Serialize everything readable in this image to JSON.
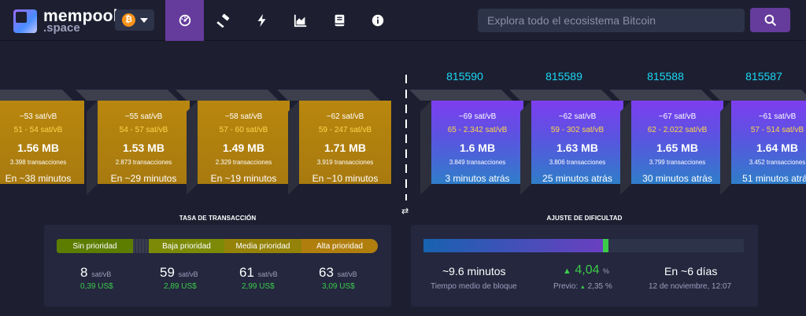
{
  "brand": {
    "name": "mempool",
    "suffix": ".space"
  },
  "network": {
    "icon": "bitcoin-icon",
    "symbol": "₿"
  },
  "nav": [
    {
      "name": "dashboard-icon",
      "active": true
    },
    {
      "name": "hammer-icon",
      "active": false
    },
    {
      "name": "lightning-icon",
      "active": false
    },
    {
      "name": "graphs-icon",
      "active": false
    },
    {
      "name": "docs-icon",
      "active": false
    },
    {
      "name": "info-icon",
      "active": false
    }
  ],
  "search": {
    "placeholder": "Explora todo el ecosistema Bitcoin"
  },
  "mempool_blocks": [
    {
      "fee": "~53 sat/vB",
      "range": "51 - 54 sat/vB",
      "size": "1.56 MB",
      "tx": "3.398 transacciones",
      "time": "En ~38 minutos"
    },
    {
      "fee": "~55 sat/vB",
      "range": "54 - 57 sat/vB",
      "size": "1.53 MB",
      "tx": "2.873 transacciones",
      "time": "En ~29 minutos"
    },
    {
      "fee": "~58 sat/vB",
      "range": "57 - 60 sat/vB",
      "size": "1.49 MB",
      "tx": "2.329 transacciones",
      "time": "En ~19 minutos"
    },
    {
      "fee": "~62 sat/vB",
      "range": "59 - 247 sat/vB",
      "size": "1.71 MB",
      "tx": "3.919 transacciones",
      "time": "En ~10 minutos"
    }
  ],
  "mined_blocks": [
    {
      "height": "815590",
      "fee": "~69 sat/vB",
      "range": "65 - 2.342 sat/vB",
      "size": "1.6 MB",
      "tx": "3.849 transacciones",
      "time": "3 minutos atrás"
    },
    {
      "height": "815589",
      "fee": "~62 sat/vB",
      "range": "59 - 302 sat/vB",
      "size": "1.63 MB",
      "tx": "3.806 transacciones",
      "time": "25 minutos atrás"
    },
    {
      "height": "815588",
      "fee": "~67 sat/vB",
      "range": "62 - 2.022 sat/vB",
      "size": "1.65 MB",
      "tx": "3.799 transacciones",
      "time": "30 minutos atrás"
    },
    {
      "height": "815587",
      "fee": "~61 sat/vB",
      "range": "57 - 514 sat/vB",
      "size": "1.64 MB",
      "tx": "3.452 transacciones",
      "time": "51 minutos atrás"
    }
  ],
  "swap_symbol": "⇄",
  "fees": {
    "title": "TASA DE TRANSACCIÓN",
    "levels": [
      {
        "label": "Sin prioridad",
        "value": "8",
        "unit": "sat/vB",
        "usd": "0,39 US$"
      },
      {
        "label": "Baja prioridad",
        "value": "59",
        "unit": "sat/vB",
        "usd": "2,89 US$"
      },
      {
        "label": "Media prioridad",
        "value": "61",
        "unit": "sat/vB",
        "usd": "2,99 US$"
      },
      {
        "label": "Alta prioridad",
        "value": "63",
        "unit": "sat/vB",
        "usd": "3,09 US$"
      }
    ]
  },
  "difficulty": {
    "title": "AJUSTE DE DIFICULTAD",
    "progress": 0.56,
    "block_time": "~9.6 minutos",
    "block_time_label": "Tiempo medio de bloque",
    "change": "4,04",
    "change_unit": "%",
    "previous_label": "Previo:",
    "previous": "2,35 %",
    "eta": "En ~6 días",
    "eta_date": "12 de noviembre, 12:07"
  }
}
